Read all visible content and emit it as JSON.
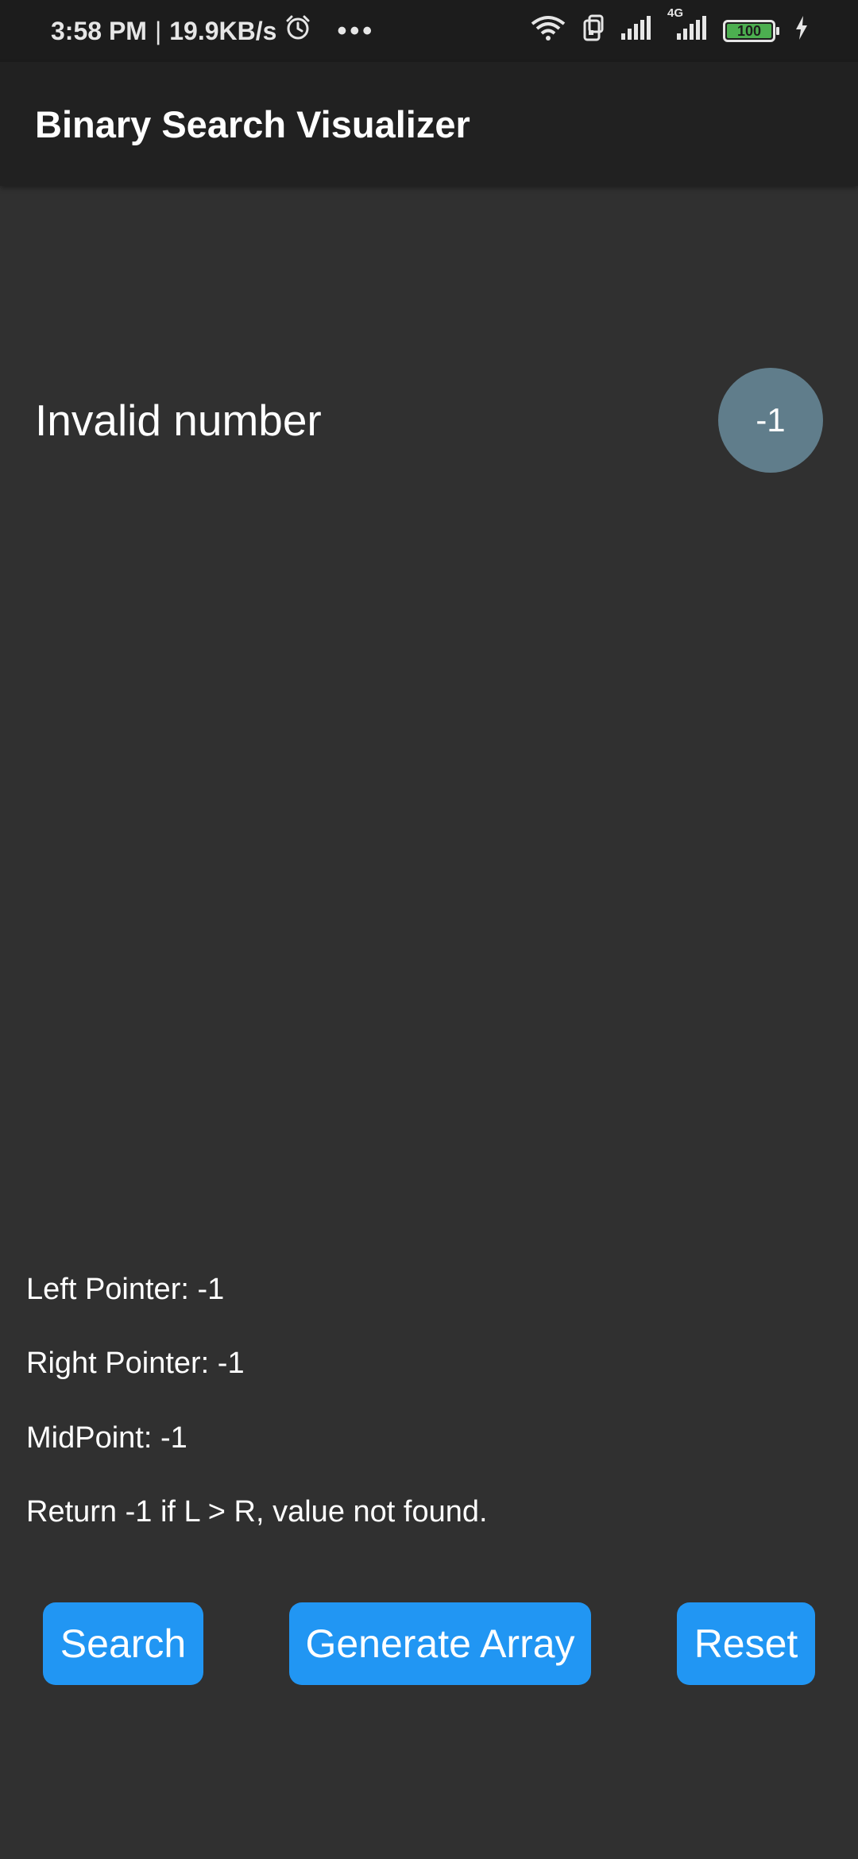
{
  "status_bar": {
    "time": "3:58 PM",
    "separator": "|",
    "speed": "19.9KB/s",
    "more": "•••",
    "network": "4G",
    "battery": "100",
    "icons": [
      "alarm-icon",
      "wifi-icon",
      "sim-icon",
      "signal-icon",
      "signal-4g-icon",
      "battery-icon",
      "charging-icon"
    ]
  },
  "app_bar": {
    "title": "Binary Search Visualizer"
  },
  "result": {
    "message": "Invalid number",
    "value": "-1"
  },
  "info": {
    "left_pointer": "Left Pointer: -1",
    "right_pointer": "Right Pointer: -1",
    "midpoint": "MidPoint: -1",
    "note": "Return -1 if L > R, value not found."
  },
  "buttons": {
    "search": "Search",
    "generate": "Generate Array",
    "reset": "Reset"
  },
  "colors": {
    "background": "#303030",
    "app_bar": "#212121",
    "button": "#2196f3",
    "circle": "#607d8b"
  }
}
